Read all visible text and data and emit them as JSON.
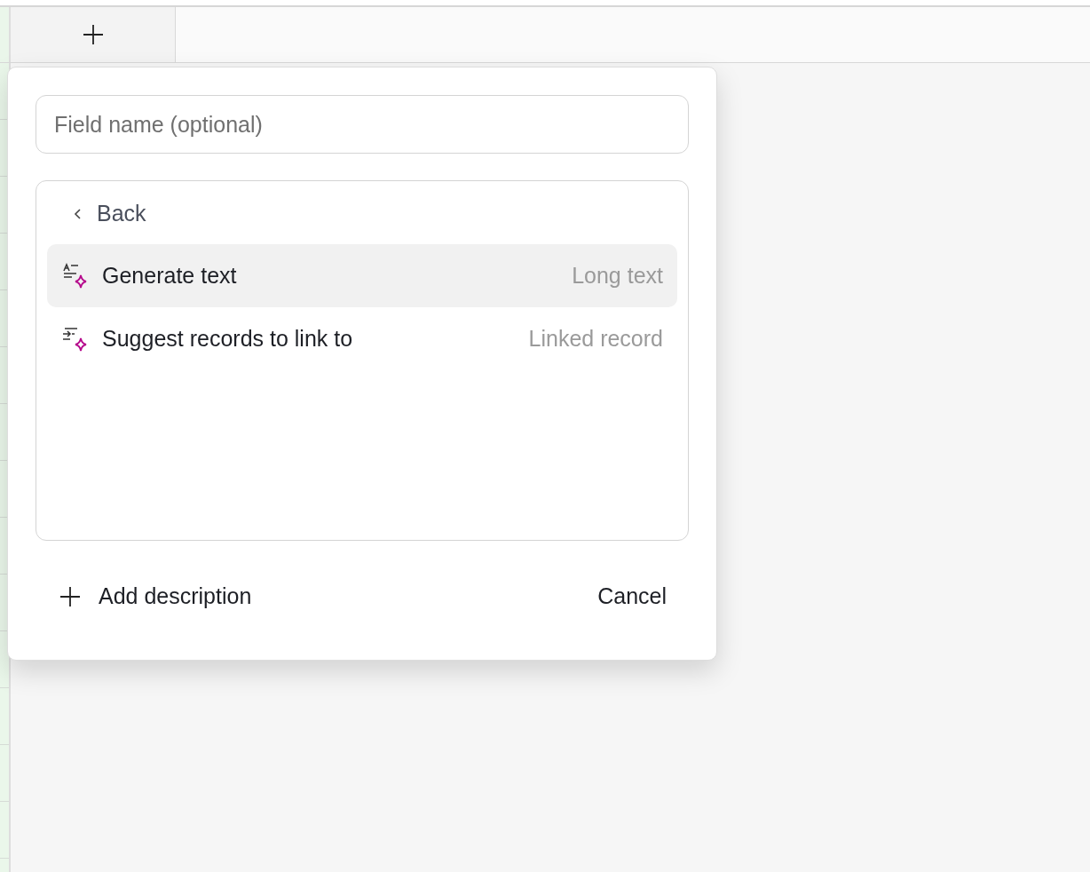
{
  "popup": {
    "field_name": {
      "placeholder": "Field name (optional)"
    },
    "back": {
      "label": "Back"
    },
    "options": [
      {
        "kind": "generate",
        "label": "Generate text",
        "type": "Long text",
        "selected": true
      },
      {
        "kind": "suggest",
        "label": "Suggest records to link to",
        "type": "Linked record",
        "selected": false
      }
    ],
    "footer": {
      "add_description": "Add description",
      "cancel": "Cancel"
    }
  }
}
